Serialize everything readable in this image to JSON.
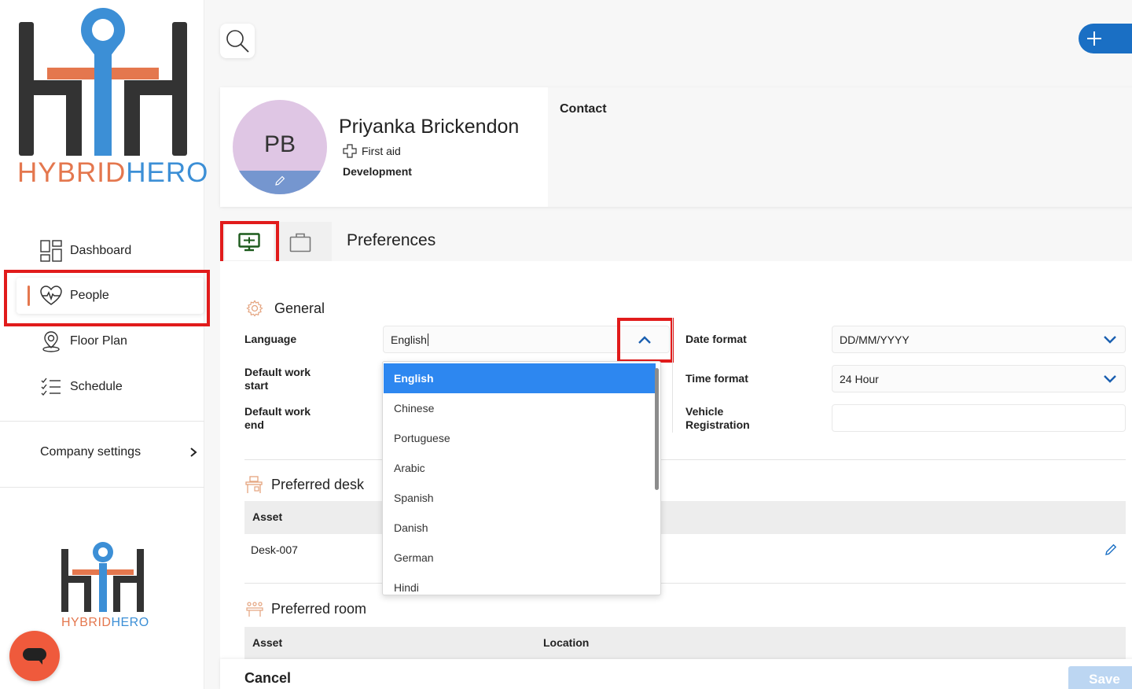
{
  "brand": {
    "logo_text_part1": "HYBRID",
    "logo_text_part2": "HERO",
    "accent_orange": "#e4774e",
    "accent_blue": "#3c8fd6",
    "primary_blue": "#1a6fc4"
  },
  "sidebar": {
    "items": [
      {
        "label": "Dashboard",
        "icon": "dashboard-icon"
      },
      {
        "label": "People",
        "icon": "heart-pulse-icon",
        "active": true
      },
      {
        "label": "Floor Plan",
        "icon": "map-pin-icon"
      },
      {
        "label": "Schedule",
        "icon": "checklist-icon"
      }
    ],
    "company_settings": "Company settings"
  },
  "profile": {
    "initials": "PB",
    "name": "Priyanka Brickendon",
    "badge": "First aid",
    "department": "Development",
    "contact_label": "Contact"
  },
  "tabs": {
    "title": "Preferences"
  },
  "general": {
    "title": "General",
    "language_label": "Language",
    "language_value": "English",
    "work_start_label_1": "Default work",
    "work_start_label_2": "start",
    "work_end_label_1": "Default work",
    "work_end_label_2": "end",
    "date_format_label": "Date format",
    "date_format_value": "DD/MM/YYYY",
    "time_format_label": "Time format",
    "time_format_value": "24 Hour",
    "vehicle_label_1": "Vehicle",
    "vehicle_label_2": "Registration",
    "vehicle_value": ""
  },
  "language_options": [
    "English",
    "Chinese",
    "Portuguese",
    "Arabic",
    "Spanish",
    "Danish",
    "German",
    "Hindi"
  ],
  "preferred_desk": {
    "title": "Preferred desk",
    "col_asset": "Asset",
    "row_asset": "Desk-007"
  },
  "preferred_room": {
    "title": "Preferred room",
    "col_asset": "Asset",
    "col_location": "Location"
  },
  "footer": {
    "cancel": "Cancel",
    "save": "Save"
  }
}
